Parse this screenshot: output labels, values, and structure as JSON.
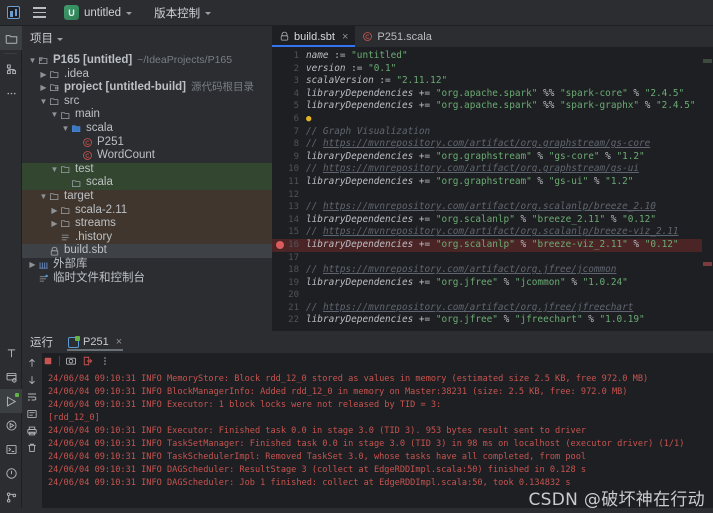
{
  "topbar": {
    "logo_icon": "intellij-logo-icon",
    "menu_icon": "hamburger-menu-icon",
    "project_badge": "U",
    "project_name": "untitled",
    "vcs_label": "版本控制",
    "chevron_icon": "chevron-down-icon"
  },
  "rail": {
    "top_items": [
      {
        "name": "project-tool-window",
        "icon": "folder-icon",
        "selected": true
      },
      {
        "name": "structure-tool-window",
        "icon": "structure-icon",
        "selected": false
      },
      {
        "name": "more-tool-windows",
        "icon": "ellipsis-icon",
        "selected": false
      }
    ],
    "bottom_items": [
      {
        "name": "typography-tool",
        "icon": "text-t-icon",
        "selected": false
      },
      {
        "name": "services-tool-window",
        "icon": "services-icon",
        "selected": false
      },
      {
        "name": "run-tool-window",
        "icon": "run-play-icon",
        "selected": true
      },
      {
        "name": "debug-tool-window",
        "icon": "debug-icon",
        "selected": false
      },
      {
        "name": "terminal-tool-window",
        "icon": "terminal-icon",
        "selected": false
      },
      {
        "name": "problems-tool-window",
        "icon": "warning-circle-icon",
        "selected": false
      },
      {
        "name": "version-control-tool-window",
        "icon": "git-branch-icon",
        "selected": false
      }
    ]
  },
  "project_panel": {
    "title": "项目",
    "chevron_icon": "chevron-down-icon",
    "tree": [
      {
        "indent": 0,
        "arrow": "▼",
        "icon": "module-icon",
        "label": "P165 [untitled]",
        "hint": "~/IdeaProjects/P165",
        "bold": true,
        "highlight": "none"
      },
      {
        "indent": 1,
        "arrow": "▶",
        "icon": "folder-icon",
        "label": ".idea",
        "hint": "",
        "bold": false,
        "highlight": "none"
      },
      {
        "indent": 1,
        "arrow": "▶",
        "icon": "module-folder-icon",
        "label": "project [untitled-build]",
        "hint": "源代码根目录",
        "bold": true,
        "highlight": "none"
      },
      {
        "indent": 1,
        "arrow": "▼",
        "icon": "folder-icon",
        "label": "src",
        "hint": "",
        "bold": false,
        "highlight": "none"
      },
      {
        "indent": 2,
        "arrow": "▼",
        "icon": "folder-icon",
        "label": "main",
        "hint": "",
        "bold": false,
        "highlight": "none"
      },
      {
        "indent": 3,
        "arrow": "▼",
        "icon": "source-folder-icon",
        "label": "scala",
        "hint": "",
        "bold": false,
        "highlight": "none"
      },
      {
        "indent": 4,
        "arrow": "",
        "icon": "scala-class-icon",
        "label": "P251",
        "hint": "",
        "bold": false,
        "highlight": "none"
      },
      {
        "indent": 4,
        "arrow": "",
        "icon": "scala-class-icon",
        "label": "WordCount",
        "hint": "",
        "bold": false,
        "highlight": "none"
      },
      {
        "indent": 2,
        "arrow": "▼",
        "icon": "folder-icon",
        "label": "test",
        "hint": "",
        "bold": false,
        "highlight": "green"
      },
      {
        "indent": 3,
        "arrow": "",
        "icon": "folder-icon",
        "label": "scala",
        "hint": "",
        "bold": false,
        "highlight": "green"
      },
      {
        "indent": 1,
        "arrow": "▼",
        "icon": "folder-icon",
        "label": "target",
        "hint": "",
        "bold": false,
        "highlight": "brown"
      },
      {
        "indent": 2,
        "arrow": "▶",
        "icon": "folder-icon",
        "label": "scala-2.11",
        "hint": "",
        "bold": false,
        "highlight": "brown"
      },
      {
        "indent": 2,
        "arrow": "▶",
        "icon": "folder-icon",
        "label": "streams",
        "hint": "",
        "bold": false,
        "highlight": "brown"
      },
      {
        "indent": 2,
        "arrow": "",
        "icon": "file-list-icon",
        "label": ".history",
        "hint": "",
        "bold": false,
        "highlight": "brown"
      },
      {
        "indent": 1,
        "arrow": "",
        "icon": "sbt-file-icon",
        "label": "build.sbt",
        "hint": "",
        "bold": false,
        "highlight": "selected"
      },
      {
        "indent": 0,
        "arrow": "▶",
        "icon": "library-icon",
        "label": "外部库",
        "hint": "",
        "bold": false,
        "highlight": "none"
      },
      {
        "indent": 0,
        "arrow": "",
        "icon": "scratches-icon",
        "label": "临时文件和控制台",
        "hint": "",
        "bold": false,
        "highlight": "none"
      }
    ]
  },
  "editor": {
    "tabs": [
      {
        "label": "build.sbt",
        "icon": "sbt-file-icon",
        "active": true,
        "close_icon": "close-icon"
      },
      {
        "label": "P251.scala",
        "icon": "scala-class-icon",
        "active": false,
        "close_icon": ""
      }
    ],
    "lines": [
      {
        "n": "1",
        "marker": "none",
        "segments": [
          {
            "c": "ident",
            "t": "name"
          },
          {
            "c": "op",
            "t": " := "
          },
          {
            "c": "str",
            "t": "\"untitled\""
          }
        ]
      },
      {
        "n": "2",
        "marker": "none",
        "segments": [
          {
            "c": "ident",
            "t": "version"
          },
          {
            "c": "op",
            "t": " := "
          },
          {
            "c": "str",
            "t": "\"0.1\""
          }
        ]
      },
      {
        "n": "3",
        "marker": "none",
        "segments": [
          {
            "c": "ident",
            "t": "scalaVersion"
          },
          {
            "c": "op",
            "t": " := "
          },
          {
            "c": "str",
            "t": "\"2.11.12\""
          }
        ]
      },
      {
        "n": "4",
        "marker": "none",
        "segments": [
          {
            "c": "ident",
            "t": "libraryDependencies"
          },
          {
            "c": "op",
            "t": " += "
          },
          {
            "c": "str",
            "t": "\"org.apache.spark\""
          },
          {
            "c": "op",
            "t": " %% "
          },
          {
            "c": "str",
            "t": "\"spark-core\""
          },
          {
            "c": "op",
            "t": " % "
          },
          {
            "c": "str",
            "t": "\"2.4.5\""
          }
        ]
      },
      {
        "n": "5",
        "marker": "none",
        "segments": [
          {
            "c": "ident",
            "t": "libraryDependencies"
          },
          {
            "c": "op",
            "t": " += "
          },
          {
            "c": "str",
            "t": "\"org.apache.spark\""
          },
          {
            "c": "op",
            "t": " %% "
          },
          {
            "c": "str",
            "t": "\"spark-graphx\""
          },
          {
            "c": "op",
            "t": " % "
          },
          {
            "c": "str",
            "t": "\"2.4.5\""
          }
        ]
      },
      {
        "n": "6",
        "marker": "bulb",
        "segments": []
      },
      {
        "n": "7",
        "marker": "none",
        "segments": [
          {
            "c": "cmt",
            "t": "// Graph Visualization"
          }
        ]
      },
      {
        "n": "8",
        "marker": "none",
        "segments": [
          {
            "c": "cmt",
            "t": "// "
          },
          {
            "c": "lnk",
            "t": "https://mvnrepository.com/artifact/org.graphstream/gs-core"
          }
        ]
      },
      {
        "n": "9",
        "marker": "none",
        "segments": [
          {
            "c": "ident",
            "t": "libraryDependencies"
          },
          {
            "c": "op",
            "t": " += "
          },
          {
            "c": "str",
            "t": "\"org.graphstream\""
          },
          {
            "c": "op",
            "t": " % "
          },
          {
            "c": "str",
            "t": "\"gs-core\""
          },
          {
            "c": "op",
            "t": " % "
          },
          {
            "c": "str",
            "t": "\"1.2\""
          }
        ]
      },
      {
        "n": "10",
        "marker": "none",
        "segments": [
          {
            "c": "cmt",
            "t": "// "
          },
          {
            "c": "lnk",
            "t": "https://mvnrepository.com/artifact/org.graphstream/gs-ui"
          }
        ]
      },
      {
        "n": "11",
        "marker": "none",
        "segments": [
          {
            "c": "ident",
            "t": "libraryDependencies"
          },
          {
            "c": "op",
            "t": " += "
          },
          {
            "c": "str",
            "t": "\"org.graphstream\""
          },
          {
            "c": "op",
            "t": " % "
          },
          {
            "c": "str",
            "t": "\"gs-ui\""
          },
          {
            "c": "op",
            "t": " % "
          },
          {
            "c": "str",
            "t": "\"1.2\""
          }
        ]
      },
      {
        "n": "12",
        "marker": "none",
        "segments": []
      },
      {
        "n": "13",
        "marker": "none",
        "segments": [
          {
            "c": "cmt",
            "t": "// "
          },
          {
            "c": "lnk",
            "t": "https://mvnrepository.com/artifact/org.scalanlp/breeze_2.10"
          }
        ]
      },
      {
        "n": "14",
        "marker": "none",
        "segments": [
          {
            "c": "ident",
            "t": "libraryDependencies"
          },
          {
            "c": "op",
            "t": " += "
          },
          {
            "c": "str",
            "t": "\"org.scalanlp\""
          },
          {
            "c": "op",
            "t": " % "
          },
          {
            "c": "str",
            "t": "\"breeze_2.11\""
          },
          {
            "c": "op",
            "t": " % "
          },
          {
            "c": "str",
            "t": "\"0.12\""
          }
        ]
      },
      {
        "n": "15",
        "marker": "none",
        "segments": [
          {
            "c": "cmt",
            "t": "// "
          },
          {
            "c": "lnk",
            "t": "https://mvnrepository.com/artifact/org.scalanlp/breeze-viz_2.11"
          }
        ]
      },
      {
        "n": "16",
        "marker": "breakpoint",
        "error": true,
        "segments": [
          {
            "c": "ident",
            "t": "libraryDependencies"
          },
          {
            "c": "op",
            "t": " += "
          },
          {
            "c": "str",
            "t": "\"org.scalanlp\""
          },
          {
            "c": "op",
            "t": " % "
          },
          {
            "c": "str",
            "t": "\"breeze-viz_2.11\""
          },
          {
            "c": "op",
            "t": " % "
          },
          {
            "c": "str",
            "t": "\"0.12\""
          }
        ]
      },
      {
        "n": "17",
        "marker": "none",
        "segments": []
      },
      {
        "n": "18",
        "marker": "none",
        "segments": [
          {
            "c": "cmt",
            "t": "// "
          },
          {
            "c": "lnk",
            "t": "https://mvnrepository.com/artifact/org.jfree/jcommon"
          }
        ]
      },
      {
        "n": "19",
        "marker": "none",
        "segments": [
          {
            "c": "ident",
            "t": "libraryDependencies"
          },
          {
            "c": "op",
            "t": " += "
          },
          {
            "c": "str",
            "t": "\"org.jfree\""
          },
          {
            "c": "op",
            "t": " % "
          },
          {
            "c": "str",
            "t": "\"jcommon\""
          },
          {
            "c": "op",
            "t": " % "
          },
          {
            "c": "str",
            "t": "\"1.0.24\""
          }
        ]
      },
      {
        "n": "20",
        "marker": "none",
        "segments": []
      },
      {
        "n": "21",
        "marker": "none",
        "segments": [
          {
            "c": "cmt",
            "t": "// "
          },
          {
            "c": "lnk",
            "t": "https://mvnrepository.com/artifact/org.jfree/jfreechart"
          }
        ]
      },
      {
        "n": "22",
        "marker": "none",
        "segments": [
          {
            "c": "ident",
            "t": "libraryDependencies"
          },
          {
            "c": "op",
            "t": " += "
          },
          {
            "c": "str",
            "t": "\"org.jfree\""
          },
          {
            "c": "op",
            "t": " % "
          },
          {
            "c": "str",
            "t": "\"jfreechart\""
          },
          {
            "c": "op",
            "t": " % "
          },
          {
            "c": "str",
            "t": "\"1.0.19\""
          }
        ]
      }
    ]
  },
  "run_panel": {
    "title": "运行",
    "tab_label": "P251",
    "tab_close_icon": "close-icon",
    "toolbar": [
      {
        "name": "rerun-button",
        "icon": "rerun-icon"
      },
      {
        "name": "stop-button",
        "icon": "stop-square-icon"
      },
      {
        "name": "screenshot-button",
        "icon": "camera-icon"
      },
      {
        "name": "exit-button",
        "icon": "exit-icon"
      },
      {
        "name": "more-options-button",
        "icon": "vertical-ellipsis-icon"
      }
    ],
    "side_tools": [
      {
        "name": "scroll-up-button",
        "icon": "arrow-up-icon"
      },
      {
        "name": "scroll-down-button",
        "icon": "arrow-down-icon"
      },
      {
        "name": "soft-wrap-button",
        "icon": "soft-wrap-icon"
      },
      {
        "name": "scroll-to-end-button",
        "icon": "scroll-end-icon"
      },
      {
        "name": "print-button",
        "icon": "printer-icon"
      },
      {
        "name": "clear-all-button",
        "icon": "trash-icon"
      }
    ],
    "console_lines": [
      "24/06/04 09:10:31 INFO MemoryStore: Block rdd_12_0 stored as values in memory (estimated size 2.5 KB, free 972.0 MB)",
      "24/06/04 09:10:31 INFO BlockManagerInfo: Added rdd_12_0 in memory on Master:38231 (size: 2.5 KB, free: 972.0 MB)",
      "24/06/04 09:10:31 INFO Executor: 1 block locks were not released by TID = 3:",
      "[rdd_12_0]",
      "24/06/04 09:10:31 INFO Executor: Finished task 0.0 in stage 3.0 (TID 3). 953 bytes result sent to driver",
      "24/06/04 09:10:31 INFO TaskSetManager: Finished task 0.0 in stage 3.0 (TID 3) in 98 ms on localhost (executor driver) (1/1)",
      "24/06/04 09:10:31 INFO TaskSchedulerImpl: Removed TaskSet 3.0, whose tasks have all completed, from pool",
      "24/06/04 09:10:31 INFO DAGScheduler: ResultStage 3 (collect at EdgeRDDImpl.scala:50) finished in 0.128 s",
      "24/06/04 09:10:31 INFO DAGScheduler: Job 1 finished: collect at EdgeRDDImpl.scala:50, took 0.134832 s"
    ]
  },
  "watermark": {
    "text": "CSDN @破坏神在行动"
  },
  "colors": {
    "accent": "#3574f0",
    "error": "#c75450",
    "string": "#6aab73",
    "comment": "#5f6570",
    "panel_bg": "#2b2d30",
    "editor_bg": "#1e1f22"
  }
}
